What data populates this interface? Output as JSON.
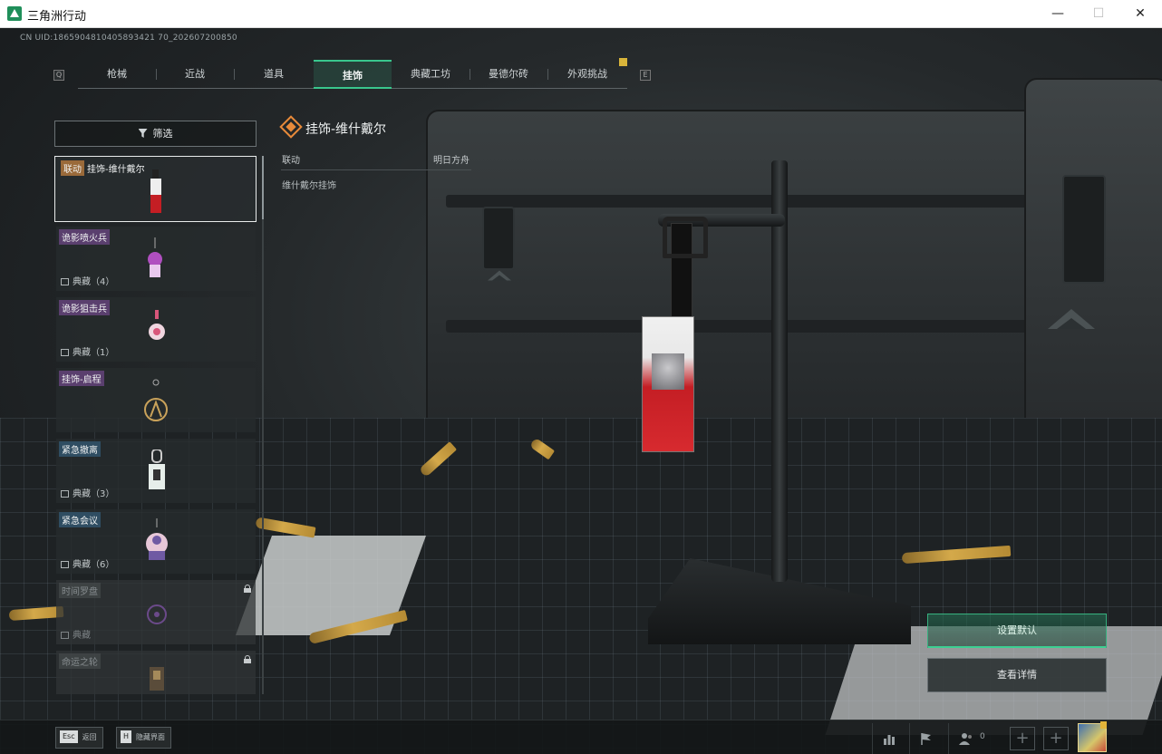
{
  "window": {
    "title": "三角洲行动",
    "minimize": "—",
    "maximize": "☐",
    "close": "✕"
  },
  "uid": "CN UID:1865904810405893421 70_202607200850",
  "nav": {
    "left_key": "Q",
    "right_key": "E",
    "tabs": [
      {
        "label": "枪械",
        "active": false
      },
      {
        "label": "近战",
        "active": false
      },
      {
        "label": "道具",
        "active": false
      },
      {
        "label": "挂饰",
        "active": true
      },
      {
        "label": "典藏工坊",
        "active": false
      },
      {
        "label": "曼德尔砖",
        "active": false
      },
      {
        "label": "外观挑战",
        "active": false
      }
    ]
  },
  "filter": {
    "label": "筛选"
  },
  "list": [
    {
      "tag": "联动",
      "name": "挂饰-维什戴尔",
      "count": "",
      "locked": false,
      "selected": true
    },
    {
      "tag": "",
      "name": "诡影喷火兵",
      "count": "典藏（4）",
      "locked": false,
      "selected": false
    },
    {
      "tag": "",
      "name": "诡影狙击兵",
      "count": "典藏（1）",
      "locked": false,
      "selected": false
    },
    {
      "tag": "",
      "name": "挂饰-启程",
      "count": "",
      "locked": false,
      "selected": false
    },
    {
      "tag": "",
      "name": "紧急撤离",
      "count": "典藏（3）",
      "locked": false,
      "selected": false
    },
    {
      "tag": "",
      "name": "紧急会议",
      "count": "典藏（6）",
      "locked": false,
      "selected": false
    },
    {
      "tag": "",
      "name": "时间罗盘",
      "count": "典藏",
      "locked": true,
      "selected": false
    },
    {
      "tag": "",
      "name": "命运之轮",
      "count": "",
      "locked": true,
      "selected": false
    }
  ],
  "detail": {
    "title": "挂饰-维什戴尔",
    "row_key": "联动",
    "row_value": "明日方舟",
    "description": "维什戴尔挂饰"
  },
  "actions": {
    "set_default": "设置默认",
    "view_details": "查看详情"
  },
  "bottom": {
    "esc_key": "Esc",
    "esc_label": "返回",
    "h_key": "H",
    "h_label": "隐藏界面",
    "friends_count": "0"
  },
  "colors": {
    "accent_green": "#39c68d",
    "selected_border": "#e9ecec",
    "tag_collab": "#9a6a3a",
    "tag_purple": "#5a3f6e",
    "tag_blue": "#2f4d62",
    "icon_orange": "#e88a3a"
  },
  "icons": {
    "filter": "filter-funnel-icon",
    "collection": "collection-image-icon",
    "lock": "lock-icon",
    "detail": "diamond-item-icon",
    "stats": "bar-chart-icon",
    "flag": "flag-icon",
    "friends": "friends-icon",
    "add": "plus-icon"
  }
}
